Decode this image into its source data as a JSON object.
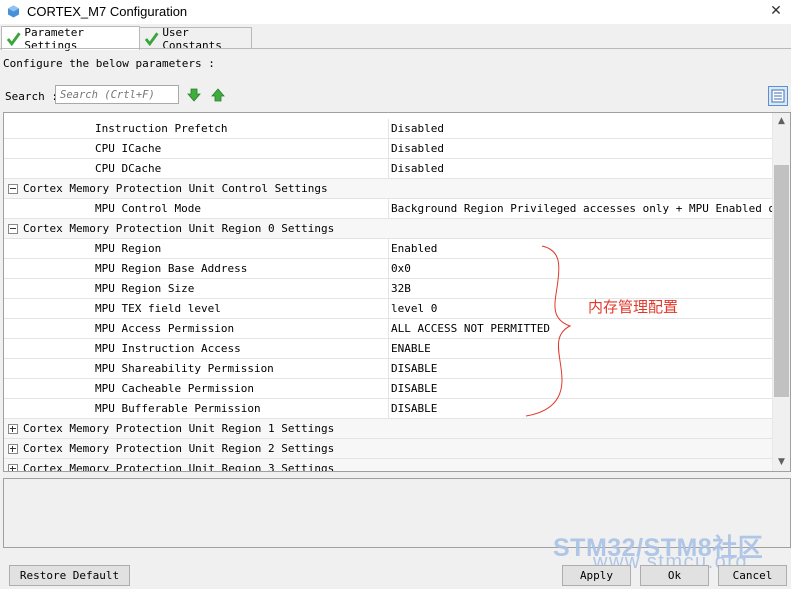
{
  "window": {
    "title": "CORTEX_M7 Configuration",
    "close_glyph": "✕"
  },
  "tabs": [
    {
      "label": "Parameter Settings",
      "icon": "check-icon",
      "active": true
    },
    {
      "label": "User Constants",
      "icon": "check-icon",
      "active": false
    }
  ],
  "instructions": "Configure the below parameters :",
  "search": {
    "label": "Search :",
    "placeholder": "Search (Crtl+F)"
  },
  "rows": [
    {
      "type": "param",
      "name": "Instruction Prefetch",
      "value": "Disabled"
    },
    {
      "type": "param",
      "name": "CPU ICache",
      "value": "Disabled"
    },
    {
      "type": "param",
      "name": "CPU DCache",
      "value": "Disabled"
    },
    {
      "type": "section",
      "name": "Cortex Memory Protection Unit Control Settings",
      "expanded": true
    },
    {
      "type": "param",
      "name": "MPU Control Mode",
      "value": "Background Region Privileged accesses only + MPU Enabled dur..."
    },
    {
      "type": "section",
      "name": "Cortex Memory Protection Unit Region 0 Settings",
      "expanded": true
    },
    {
      "type": "param",
      "name": "MPU Region",
      "value": "Enabled"
    },
    {
      "type": "param",
      "name": "MPU Region Base Address",
      "value": "0x0"
    },
    {
      "type": "param",
      "name": "MPU Region Size",
      "value": "32B"
    },
    {
      "type": "param",
      "name": "MPU TEX field level",
      "value": "level 0"
    },
    {
      "type": "param",
      "name": "MPU Access Permission",
      "value": "ALL ACCESS NOT PERMITTED"
    },
    {
      "type": "param",
      "name": "MPU Instruction Access",
      "value": "ENABLE"
    },
    {
      "type": "param",
      "name": "MPU Shareability Permission",
      "value": "DISABLE"
    },
    {
      "type": "param",
      "name": "MPU Cacheable Permission",
      "value": "DISABLE"
    },
    {
      "type": "param",
      "name": "MPU Bufferable  Permission",
      "value": "DISABLE"
    },
    {
      "type": "section",
      "name": "Cortex Memory Protection Unit Region 1 Settings",
      "expanded": false
    },
    {
      "type": "section",
      "name": "Cortex Memory Protection Unit Region 2 Settings",
      "expanded": false
    },
    {
      "type": "section",
      "name": "Cortex Memory Protection Unit Region 3 Settings",
      "expanded": false
    }
  ],
  "annotation": {
    "text": "内存管理配置",
    "color": "#e0392b"
  },
  "buttons": {
    "restore": "Restore Default",
    "apply": "Apply",
    "ok": "Ok",
    "cancel": "Cancel"
  },
  "watermark": {
    "brand": "STM32/STM8社区",
    "url": "www.stmcu.org"
  },
  "colors": {
    "check_green": "#3aa53a",
    "arrow_green": "#3fae3f",
    "accent_blue": "#5b8fd1"
  }
}
